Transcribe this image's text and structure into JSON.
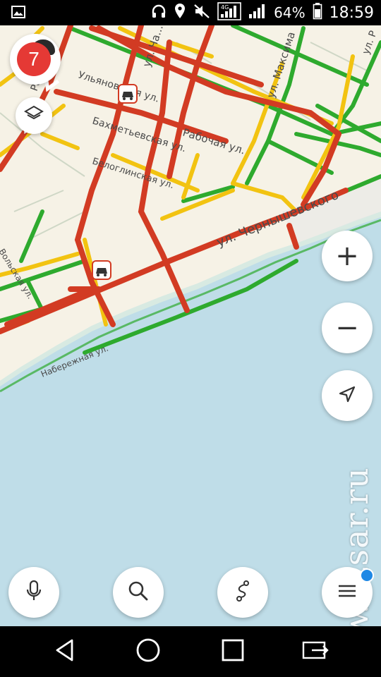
{
  "status_bar": {
    "icons": [
      "gallery-icon",
      "headphones-icon",
      "location-icon",
      "mute-icon",
      "signal-4g-icon",
      "signal-icon",
      "battery-icon"
    ],
    "network": "4G",
    "battery": "64%",
    "time": "18:59"
  },
  "map": {
    "colors": {
      "land": "#f6f2e6",
      "water": "#bfdde8",
      "jam": "#d23b23",
      "slow": "#f2c311",
      "free": "#2eaa2e",
      "road_minor": "#f3d547"
    },
    "street_labels": [
      "Ра...",
      "ул. Ча...",
      "Ульяновская ул.",
      "ул. Максима",
      "ул. Р",
      "Бахметьевская ул.",
      "Рабочая ул.",
      "Белоглинская ул.",
      "ул. Чернышевского",
      "Вольская ул.",
      "Набережная ул."
    ],
    "traffic_score": "7",
    "incident_icons": [
      "car-accident-icon",
      "car-accident-icon"
    ]
  },
  "controls": {
    "zoom_in": "+",
    "zoom_out": "−",
    "locate_icon": "navigation-arrow-icon",
    "layers_icon": "layers-icon",
    "bottom": [
      "microphone-icon",
      "search-icon",
      "route-icon",
      "menu-icon"
    ]
  },
  "watermark": "www.vzsar.ru",
  "nav_bar": [
    "back-icon",
    "home-icon",
    "recents-icon",
    "screen-cast-icon"
  ]
}
